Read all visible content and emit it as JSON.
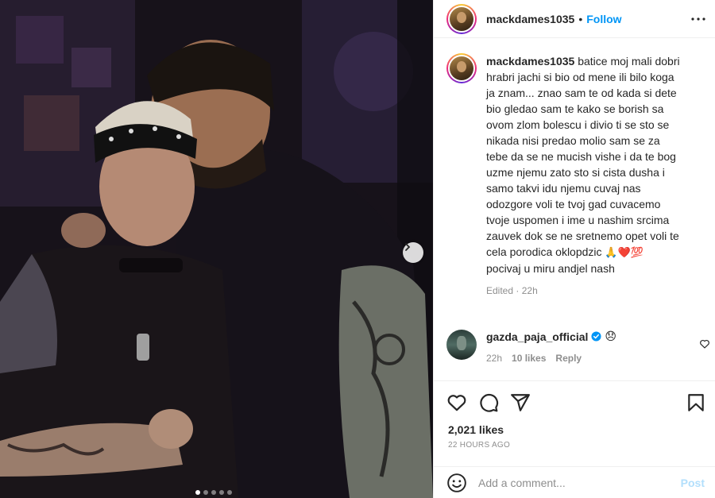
{
  "post": {
    "username": "mackdames1035",
    "separator": "•",
    "follow_label": "Follow",
    "more_icon": "more-horizontal-icon"
  },
  "caption": {
    "username": "mackdames1035",
    "text": "batice moj mali dobri hrabri jachi si bio od mene ili bilo koga ja znam... znao sam te od kada si dete bio gledao sam te kako se borish sa ovom zlom bolescu i divio ti se sto se nikada nisi predao molio sam se za tebe da se ne mucish vishe i da te bog uzme njemu zato sto si cista dusha i samo takvi idu njemu cuvaj nas odozgore voli te tvoj gad cuvacemo tvoje uspomen i ime u nashim srcima zauvek dok se ne sretnemo opet voli te cela porodica oklopdzic",
    "emojis": "🙏❤️💯",
    "text_after": "pocivaj u miru andjel nash",
    "edited": "Edited",
    "edited_sep": "·",
    "edited_time": "22h"
  },
  "comment": {
    "username": "gazda_paja_official",
    "emoji": "😞",
    "time": "22h",
    "likes": "10 likes",
    "reply": "Reply"
  },
  "stats": {
    "likes": "2,021 likes",
    "time_ago": "22 HOURS AGO"
  },
  "add_comment": {
    "placeholder": "Add a comment...",
    "post_label": "Post"
  },
  "carousel": {
    "total_slides": 5,
    "active_index": 0
  },
  "colors": {
    "link": "#0095f6",
    "post_disabled": "#b2dffc",
    "muted": "#8e8e8e",
    "text": "#262626"
  }
}
